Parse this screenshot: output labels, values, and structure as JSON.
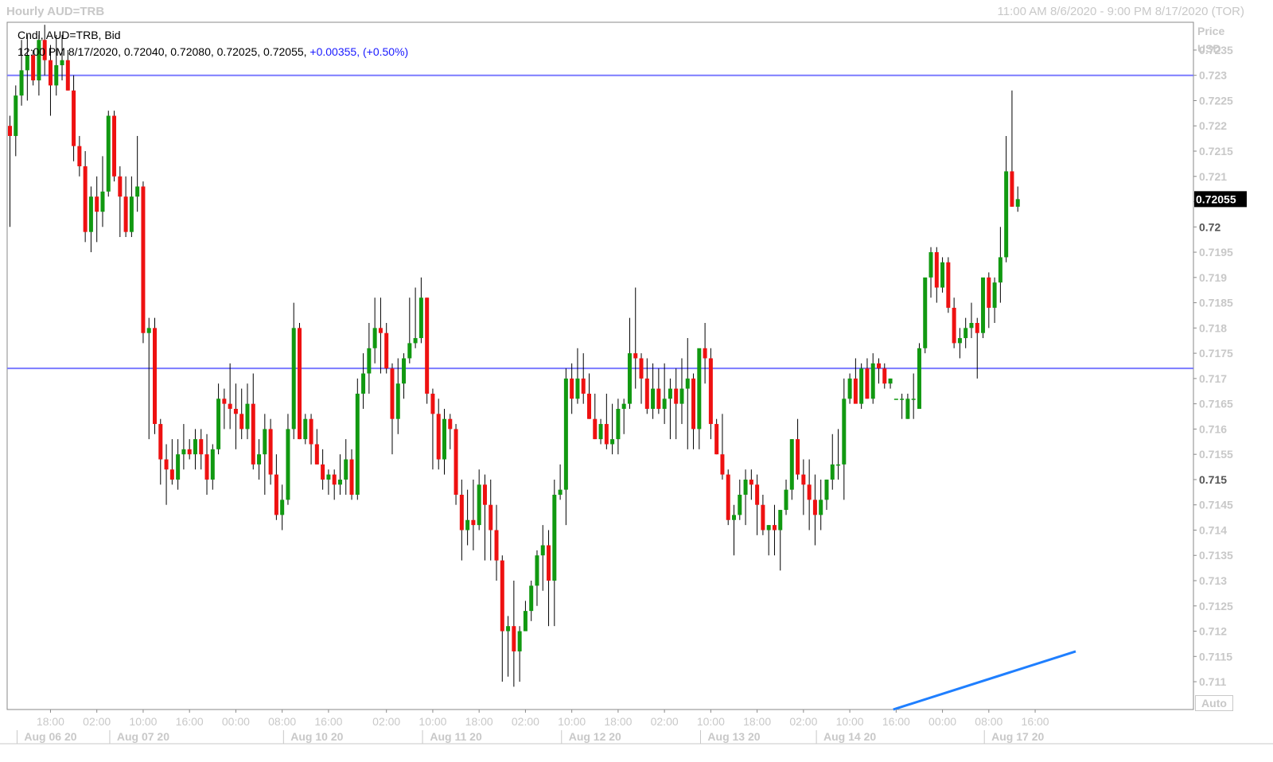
{
  "header": {
    "title": "Hourly AUD=TRB",
    "range": "11:00 AM 8/6/2020 - 9:00 PM 8/17/2020 (TOR)"
  },
  "info": {
    "line1": "Cndl, AUD=TRB, Bid",
    "line2_values": "12:00 PM 8/17/2020, 0.72040, 0.72080, 0.72025, 0.72055,",
    "change": "+0.00355,",
    "change_pct": "(+0.50%)"
  },
  "axis": {
    "price_label": "Price",
    "currency_label": "USD",
    "auto_label": "Auto",
    "current_price": "0.72055"
  },
  "colors": {
    "up": "#119911",
    "down": "#ee1111",
    "hline": "#7b7bff",
    "trend": "#1f7fff",
    "axis_text": "#c8c8c8",
    "price_badge_bg": "#000000",
    "price_badge_fg": "#ffffff"
  },
  "chart_data": {
    "type": "candlestick",
    "y_ticks": [
      "0.7235",
      "0.723",
      "0.7225",
      "0.722",
      "0.7215",
      "0.721",
      "0.7205",
      "0.72",
      "0.7195",
      "0.719",
      "0.7185",
      "0.718",
      "0.7175",
      "0.717",
      "0.7165",
      "0.716",
      "0.7155",
      "0.715",
      "0.7145",
      "0.714",
      "0.7135",
      "0.713",
      "0.7125",
      "0.712",
      "0.7115",
      "0.711"
    ],
    "y_tick_bold": [
      "0.72",
      "0.715"
    ],
    "y_range": [
      0.71045,
      0.72405
    ],
    "time_labels": [
      {
        "i": 7,
        "text": "18:00"
      },
      {
        "i": 15,
        "text": "02:00"
      },
      {
        "i": 23,
        "text": "10:00"
      },
      {
        "i": 31,
        "text": "16:00"
      },
      {
        "i": 39,
        "text": "00:00"
      },
      {
        "i": 47,
        "text": "08:00"
      },
      {
        "i": 55,
        "text": "16:00"
      },
      {
        "i": 65,
        "text": "02:00"
      },
      {
        "i": 73,
        "text": "10:00"
      },
      {
        "i": 81,
        "text": "18:00"
      },
      {
        "i": 89,
        "text": "02:00"
      },
      {
        "i": 97,
        "text": "10:00"
      },
      {
        "i": 105,
        "text": "18:00"
      },
      {
        "i": 113,
        "text": "02:00"
      },
      {
        "i": 121,
        "text": "10:00"
      },
      {
        "i": 129,
        "text": "18:00"
      },
      {
        "i": 137,
        "text": "02:00"
      },
      {
        "i": 145,
        "text": "10:00"
      },
      {
        "i": 153,
        "text": "16:00"
      },
      {
        "i": 161,
        "text": "00:00"
      },
      {
        "i": 169,
        "text": "08:00"
      },
      {
        "i": 177,
        "text": "16:00"
      }
    ],
    "date_labels": [
      {
        "i": 7,
        "text": "Aug 06 20"
      },
      {
        "i": 23,
        "text": "Aug 07 20"
      },
      {
        "i": 53,
        "text": "Aug 10 20"
      },
      {
        "i": 77,
        "text": "Aug 11 20"
      },
      {
        "i": 101,
        "text": "Aug 12 20"
      },
      {
        "i": 125,
        "text": "Aug 13 20"
      },
      {
        "i": 145,
        "text": "Aug 14 20"
      },
      {
        "i": 174,
        "text": "Aug 17 20"
      }
    ],
    "horizontal_lines": [
      0.723,
      0.7172
    ],
    "trend_line": {
      "from": {
        "i": 152.5,
        "p": 0.71045
      },
      "to": {
        "i": 184,
        "p": 0.7116
      }
    },
    "candles": [
      [
        0.722,
        0.7222,
        0.72,
        0.7218
      ],
      [
        0.7218,
        0.7228,
        0.7214,
        0.7226
      ],
      [
        0.7226,
        0.7237,
        0.7224,
        0.7231
      ],
      [
        0.7231,
        0.7238,
        0.7225,
        0.7234
      ],
      [
        0.7234,
        0.7235,
        0.7228,
        0.7229
      ],
      [
        0.7229,
        0.7238,
        0.7226,
        0.7237
      ],
      [
        0.7237,
        0.724,
        0.723,
        0.7233
      ],
      [
        0.7233,
        0.7236,
        0.7222,
        0.7228
      ],
      [
        0.7228,
        0.7238,
        0.7226,
        0.7232
      ],
      [
        0.7232,
        0.7238,
        0.7229,
        0.7233
      ],
      [
        0.7233,
        0.7235,
        0.7227,
        0.7227
      ],
      [
        0.7227,
        0.723,
        0.7213,
        0.7216
      ],
      [
        0.7216,
        0.7218,
        0.721,
        0.7212
      ],
      [
        0.7212,
        0.7215,
        0.7197,
        0.7199
      ],
      [
        0.7199,
        0.7208,
        0.7195,
        0.7206
      ],
      [
        0.7206,
        0.721,
        0.7197,
        0.7203
      ],
      [
        0.7203,
        0.7214,
        0.72,
        0.7207
      ],
      [
        0.7207,
        0.7223,
        0.7206,
        0.7222
      ],
      [
        0.7222,
        0.7223,
        0.7209,
        0.721
      ],
      [
        0.721,
        0.7212,
        0.7198,
        0.7206
      ],
      [
        0.7206,
        0.721,
        0.7198,
        0.7199
      ],
      [
        0.7199,
        0.721,
        0.7198,
        0.7206
      ],
      [
        0.7206,
        0.7218,
        0.7203,
        0.7208
      ],
      [
        0.7208,
        0.7209,
        0.7177,
        0.7179
      ],
      [
        0.7179,
        0.7182,
        0.7158,
        0.718
      ],
      [
        0.718,
        0.7182,
        0.7159,
        0.7161
      ],
      [
        0.7161,
        0.7162,
        0.7149,
        0.7154
      ],
      [
        0.7154,
        0.7157,
        0.7145,
        0.7152
      ],
      [
        0.7152,
        0.7158,
        0.7149,
        0.715
      ],
      [
        0.715,
        0.7158,
        0.7148,
        0.7155
      ],
      [
        0.7155,
        0.7161,
        0.7152,
        0.7156
      ],
      [
        0.7156,
        0.7158,
        0.7154,
        0.7155
      ],
      [
        0.7155,
        0.716,
        0.7152,
        0.7158
      ],
      [
        0.7158,
        0.716,
        0.7152,
        0.7155
      ],
      [
        0.7155,
        0.7159,
        0.7147,
        0.715
      ],
      [
        0.715,
        0.7157,
        0.7148,
        0.7156
      ],
      [
        0.7156,
        0.7169,
        0.7155,
        0.7166
      ],
      [
        0.7166,
        0.7168,
        0.716,
        0.7165
      ],
      [
        0.7165,
        0.7173,
        0.716,
        0.7164
      ],
      [
        0.7164,
        0.7169,
        0.7156,
        0.7163
      ],
      [
        0.7163,
        0.7168,
        0.7158,
        0.716
      ],
      [
        0.716,
        0.7169,
        0.7158,
        0.7165
      ],
      [
        0.7165,
        0.7171,
        0.7152,
        0.7153
      ],
      [
        0.7153,
        0.7158,
        0.715,
        0.7155
      ],
      [
        0.7155,
        0.7163,
        0.7147,
        0.716
      ],
      [
        0.716,
        0.7162,
        0.7149,
        0.7151
      ],
      [
        0.7151,
        0.7155,
        0.7142,
        0.7143
      ],
      [
        0.7143,
        0.7149,
        0.714,
        0.7146
      ],
      [
        0.7146,
        0.7163,
        0.7145,
        0.716
      ],
      [
        0.716,
        0.7185,
        0.7158,
        0.718
      ],
      [
        0.718,
        0.7181,
        0.7158,
        0.7158
      ],
      [
        0.7158,
        0.7163,
        0.7157,
        0.7162
      ],
      [
        0.7162,
        0.7163,
        0.7153,
        0.7157
      ],
      [
        0.7157,
        0.716,
        0.7153,
        0.7153
      ],
      [
        0.7153,
        0.7156,
        0.7148,
        0.715
      ],
      [
        0.715,
        0.7152,
        0.7147,
        0.7151
      ],
      [
        0.7151,
        0.7152,
        0.7146,
        0.7149
      ],
      [
        0.7149,
        0.7155,
        0.7147,
        0.715
      ],
      [
        0.715,
        0.7158,
        0.7147,
        0.7154
      ],
      [
        0.7154,
        0.7156,
        0.7146,
        0.7147
      ],
      [
        0.7147,
        0.717,
        0.7146,
        0.7167
      ],
      [
        0.7167,
        0.7175,
        0.7164,
        0.7171
      ],
      [
        0.7171,
        0.7181,
        0.7167,
        0.7176
      ],
      [
        0.7176,
        0.7186,
        0.7173,
        0.718
      ],
      [
        0.718,
        0.7186,
        0.7171,
        0.7179
      ],
      [
        0.7179,
        0.7181,
        0.7171,
        0.7172
      ],
      [
        0.7172,
        0.7173,
        0.7155,
        0.7162
      ],
      [
        0.7162,
        0.7174,
        0.7159,
        0.7169
      ],
      [
        0.7169,
        0.7175,
        0.7166,
        0.7174
      ],
      [
        0.7174,
        0.7186,
        0.7173,
        0.7177
      ],
      [
        0.7177,
        0.7188,
        0.7176,
        0.7178
      ],
      [
        0.7178,
        0.719,
        0.7177,
        0.7186
      ],
      [
        0.7186,
        0.7186,
        0.7165,
        0.7167
      ],
      [
        0.7167,
        0.7168,
        0.7152,
        0.7163
      ],
      [
        0.7163,
        0.7166,
        0.7152,
        0.7154
      ],
      [
        0.7154,
        0.7164,
        0.7151,
        0.7162
      ],
      [
        0.7162,
        0.7163,
        0.7156,
        0.716
      ],
      [
        0.716,
        0.7161,
        0.7145,
        0.7147
      ],
      [
        0.7147,
        0.715,
        0.7134,
        0.714
      ],
      [
        0.714,
        0.7148,
        0.7137,
        0.7142
      ],
      [
        0.7142,
        0.715,
        0.7136,
        0.7141
      ],
      [
        0.7141,
        0.7152,
        0.714,
        0.7149
      ],
      [
        0.7149,
        0.7151,
        0.7134,
        0.7145
      ],
      [
        0.7145,
        0.715,
        0.7134,
        0.714
      ],
      [
        0.714,
        0.7145,
        0.713,
        0.7134
      ],
      [
        0.7134,
        0.7135,
        0.711,
        0.712
      ],
      [
        0.712,
        0.7123,
        0.7111,
        0.7121
      ],
      [
        0.7121,
        0.713,
        0.7109,
        0.7116
      ],
      [
        0.7116,
        0.7121,
        0.711,
        0.712
      ],
      [
        0.712,
        0.7126,
        0.712,
        0.7124
      ],
      [
        0.7124,
        0.713,
        0.7122,
        0.7129
      ],
      [
        0.7129,
        0.7136,
        0.7125,
        0.7135
      ],
      [
        0.7135,
        0.7141,
        0.7128,
        0.7137
      ],
      [
        0.7137,
        0.714,
        0.7121,
        0.713
      ],
      [
        0.713,
        0.715,
        0.7121,
        0.7147
      ],
      [
        0.7147,
        0.7153,
        0.7146,
        0.7148
      ],
      [
        0.7148,
        0.7172,
        0.7141,
        0.717
      ],
      [
        0.717,
        0.7173,
        0.7163,
        0.7166
      ],
      [
        0.7166,
        0.7176,
        0.7165,
        0.717
      ],
      [
        0.717,
        0.7175,
        0.7165,
        0.7167
      ],
      [
        0.7167,
        0.7171,
        0.7162,
        0.7162
      ],
      [
        0.7162,
        0.7167,
        0.7158,
        0.7158
      ],
      [
        0.7158,
        0.7162,
        0.7157,
        0.7161
      ],
      [
        0.7161,
        0.7167,
        0.7156,
        0.7157
      ],
      [
        0.7157,
        0.7165,
        0.7155,
        0.7158
      ],
      [
        0.7158,
        0.7166,
        0.7155,
        0.7164
      ],
      [
        0.7164,
        0.7166,
        0.7159,
        0.7165
      ],
      [
        0.7165,
        0.7182,
        0.7164,
        0.7175
      ],
      [
        0.7175,
        0.7188,
        0.7168,
        0.7174
      ],
      [
        0.7174,
        0.7175,
        0.7165,
        0.717
      ],
      [
        0.717,
        0.7174,
        0.7163,
        0.7164
      ],
      [
        0.7164,
        0.7173,
        0.7162,
        0.7168
      ],
      [
        0.7168,
        0.7172,
        0.7163,
        0.7164
      ],
      [
        0.7164,
        0.7173,
        0.7161,
        0.7166
      ],
      [
        0.7166,
        0.717,
        0.7158,
        0.7168
      ],
      [
        0.7168,
        0.7172,
        0.7158,
        0.7165
      ],
      [
        0.7165,
        0.7174,
        0.7161,
        0.7168
      ],
      [
        0.7168,
        0.7178,
        0.7156,
        0.717
      ],
      [
        0.717,
        0.7171,
        0.7156,
        0.716
      ],
      [
        0.716,
        0.7175,
        0.7156,
        0.7176
      ],
      [
        0.7176,
        0.7181,
        0.7169,
        0.7174
      ],
      [
        0.7174,
        0.7176,
        0.7158,
        0.7161
      ],
      [
        0.7161,
        0.7162,
        0.7155,
        0.7155
      ],
      [
        0.7155,
        0.7163,
        0.715,
        0.7151
      ],
      [
        0.7151,
        0.7152,
        0.7141,
        0.7142
      ],
      [
        0.7142,
        0.7145,
        0.7135,
        0.7143
      ],
      [
        0.7143,
        0.715,
        0.7142,
        0.7147
      ],
      [
        0.7147,
        0.7152,
        0.7141,
        0.715
      ],
      [
        0.715,
        0.7152,
        0.7146,
        0.7149
      ],
      [
        0.7149,
        0.7151,
        0.7139,
        0.7145
      ],
      [
        0.7145,
        0.7147,
        0.7139,
        0.714
      ],
      [
        0.714,
        0.7141,
        0.7135,
        0.7141
      ],
      [
        0.7141,
        0.7145,
        0.7135,
        0.714
      ],
      [
        0.714,
        0.7144,
        0.7132,
        0.7144
      ],
      [
        0.7144,
        0.715,
        0.7143,
        0.7148
      ],
      [
        0.7148,
        0.7158,
        0.7146,
        0.7158
      ],
      [
        0.7158,
        0.7162,
        0.715,
        0.7151
      ],
      [
        0.7151,
        0.7154,
        0.7143,
        0.7149
      ],
      [
        0.7149,
        0.7154,
        0.714,
        0.7146
      ],
      [
        0.7146,
        0.7151,
        0.7137,
        0.7143
      ],
      [
        0.7143,
        0.715,
        0.714,
        0.7146
      ],
      [
        0.7146,
        0.715,
        0.7144,
        0.715
      ],
      [
        0.715,
        0.7159,
        0.7148,
        0.7153
      ],
      [
        0.7153,
        0.716,
        0.715,
        0.7153
      ],
      [
        0.7153,
        0.717,
        0.7146,
        0.7166
      ],
      [
        0.7166,
        0.7171,
        0.7165,
        0.717
      ],
      [
        0.717,
        0.7174,
        0.7166,
        0.7165
      ],
      [
        0.7165,
        0.7173,
        0.7164,
        0.7172
      ],
      [
        0.7172,
        0.7174,
        0.7166,
        0.7166
      ],
      [
        0.7166,
        0.7175,
        0.7165,
        0.7173
      ],
      [
        0.7173,
        0.7174,
        0.7169,
        0.7172
      ],
      [
        0.7172,
        0.7173,
        0.7168,
        0.7169
      ],
      [
        0.7169,
        0.717,
        0.7168,
        0.717
      ],
      [
        0.7166,
        0.7166,
        0.7166,
        0.7166
      ],
      [
        0.7166,
        0.7167,
        0.7162,
        0.7166
      ],
      [
        0.7162,
        0.7167,
        0.7162,
        0.7166
      ],
      [
        0.7166,
        0.7171,
        0.7162,
        0.7166
      ],
      [
        0.7164,
        0.7177,
        0.7164,
        0.7176
      ],
      [
        0.7176,
        0.7189,
        0.7175,
        0.719
      ],
      [
        0.719,
        0.7196,
        0.7186,
        0.7195
      ],
      [
        0.7195,
        0.7196,
        0.7185,
        0.7188
      ],
      [
        0.7188,
        0.7194,
        0.7187,
        0.7193
      ],
      [
        0.7193,
        0.7194,
        0.7183,
        0.7184
      ],
      [
        0.7184,
        0.7186,
        0.7176,
        0.7177
      ],
      [
        0.7177,
        0.718,
        0.7174,
        0.7178
      ],
      [
        0.7178,
        0.7182,
        0.7176,
        0.718
      ],
      [
        0.718,
        0.7185,
        0.7178,
        0.7181
      ],
      [
        0.7181,
        0.7182,
        0.717,
        0.7179
      ],
      [
        0.7179,
        0.7189,
        0.7178,
        0.719
      ],
      [
        0.719,
        0.7191,
        0.718,
        0.7184
      ],
      [
        0.7184,
        0.719,
        0.7181,
        0.7189
      ],
      [
        0.7189,
        0.72,
        0.7185,
        0.7194
      ],
      [
        0.7194,
        0.7218,
        0.7193,
        0.7211
      ],
      [
        0.7211,
        0.7227,
        0.7204,
        0.7204
      ],
      [
        0.7204,
        0.7208,
        0.7203,
        0.72055
      ]
    ]
  }
}
